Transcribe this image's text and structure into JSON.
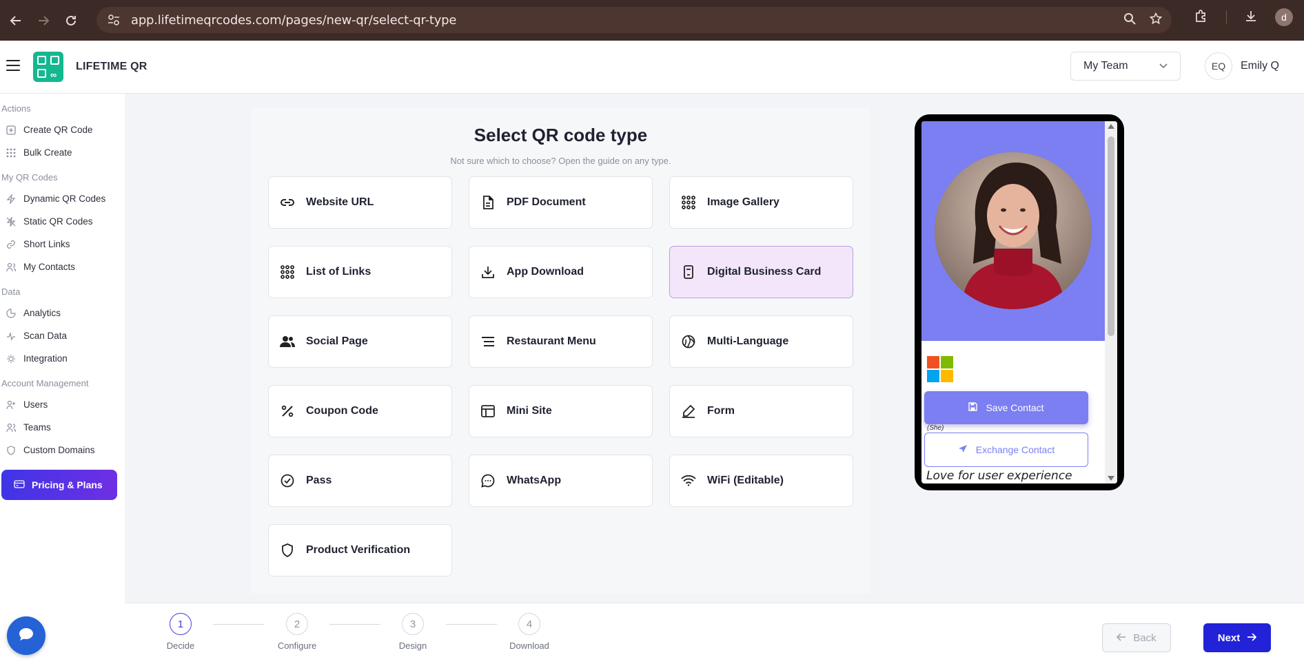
{
  "browser": {
    "url": "app.lifetimeqrcodes.com/pages/new-qr/select-qr-type",
    "profile_initial": "d"
  },
  "header": {
    "brand": "LIFETIME QR",
    "team_select": "My Team",
    "user_initials": "EQ",
    "user_name": "Emily Q"
  },
  "sidebar": {
    "sections": [
      {
        "title": "Actions",
        "items": [
          {
            "label": "Create QR Code",
            "icon": "plus-square-icon"
          },
          {
            "label": "Bulk Create",
            "icon": "grid-dots-icon"
          }
        ]
      },
      {
        "title": "My QR Codes",
        "items": [
          {
            "label": "Dynamic QR Codes",
            "icon": "bolt-icon"
          },
          {
            "label": "Static QR Codes",
            "icon": "bolt-off-icon"
          },
          {
            "label": "Short Links",
            "icon": "link-icon"
          },
          {
            "label": "My Contacts",
            "icon": "users-icon"
          }
        ]
      },
      {
        "title": "Data",
        "items": [
          {
            "label": "Analytics",
            "icon": "pie-chart-icon"
          },
          {
            "label": "Scan Data",
            "icon": "activity-icon"
          },
          {
            "label": "Integration",
            "icon": "bulb-icon"
          }
        ]
      },
      {
        "title": "Account Management",
        "items": [
          {
            "label": "Users",
            "icon": "user-plus-icon"
          },
          {
            "label": "Teams",
            "icon": "users-icon"
          },
          {
            "label": "Custom Domains",
            "icon": "shield-icon"
          }
        ]
      }
    ],
    "pricing_label": "Pricing & Plans"
  },
  "main": {
    "title": "Select QR code type",
    "subtitle": "Not sure which to choose? Open the guide on any type.",
    "types": [
      {
        "label": "Website URL",
        "icon": "link-icon",
        "selected": false
      },
      {
        "label": "PDF Document",
        "icon": "file-icon",
        "selected": false
      },
      {
        "label": "Image Gallery",
        "icon": "grid-dots-icon",
        "selected": false
      },
      {
        "label": "List of Links",
        "icon": "grid-dots-icon",
        "selected": false
      },
      {
        "label": "App Download",
        "icon": "download-icon",
        "selected": false
      },
      {
        "label": "Digital Business Card",
        "icon": "id-card-icon",
        "selected": true
      },
      {
        "label": "Social Page",
        "icon": "users-icon",
        "selected": false
      },
      {
        "label": "Restaurant Menu",
        "icon": "menu-list-icon",
        "selected": false
      },
      {
        "label": "Multi-Language",
        "icon": "globe-icon",
        "selected": false
      },
      {
        "label": "Coupon Code",
        "icon": "percent-icon",
        "selected": false
      },
      {
        "label": "Mini Site",
        "icon": "browser-window-icon",
        "selected": false
      },
      {
        "label": "Form",
        "icon": "edit-icon",
        "selected": false
      },
      {
        "label": "Pass",
        "icon": "check-circle-icon",
        "selected": false
      },
      {
        "label": "WhatsApp",
        "icon": "chat-icon",
        "selected": false
      },
      {
        "label": "WiFi (Editable)",
        "icon": "wifi-icon",
        "selected": false
      },
      {
        "label": "Product Verification",
        "icon": "shield-icon",
        "selected": false
      }
    ]
  },
  "preview": {
    "save_contact": "Save Contact",
    "pronoun": "(She)",
    "exchange_contact": "Exchange Contact",
    "bio": "Love for user experience",
    "accent": "#7b7ff2"
  },
  "stepper": {
    "steps": [
      {
        "num": "1",
        "label": "Decide",
        "active": true
      },
      {
        "num": "2",
        "label": "Configure",
        "active": false
      },
      {
        "num": "3",
        "label": "Design",
        "active": false
      },
      {
        "num": "4",
        "label": "Download",
        "active": false
      }
    ],
    "back_label": "Back",
    "next_label": "Next"
  },
  "colors": {
    "primary": "#2222d8",
    "selected_card": "#f3e6fb",
    "brand_logo": "#14b890"
  }
}
